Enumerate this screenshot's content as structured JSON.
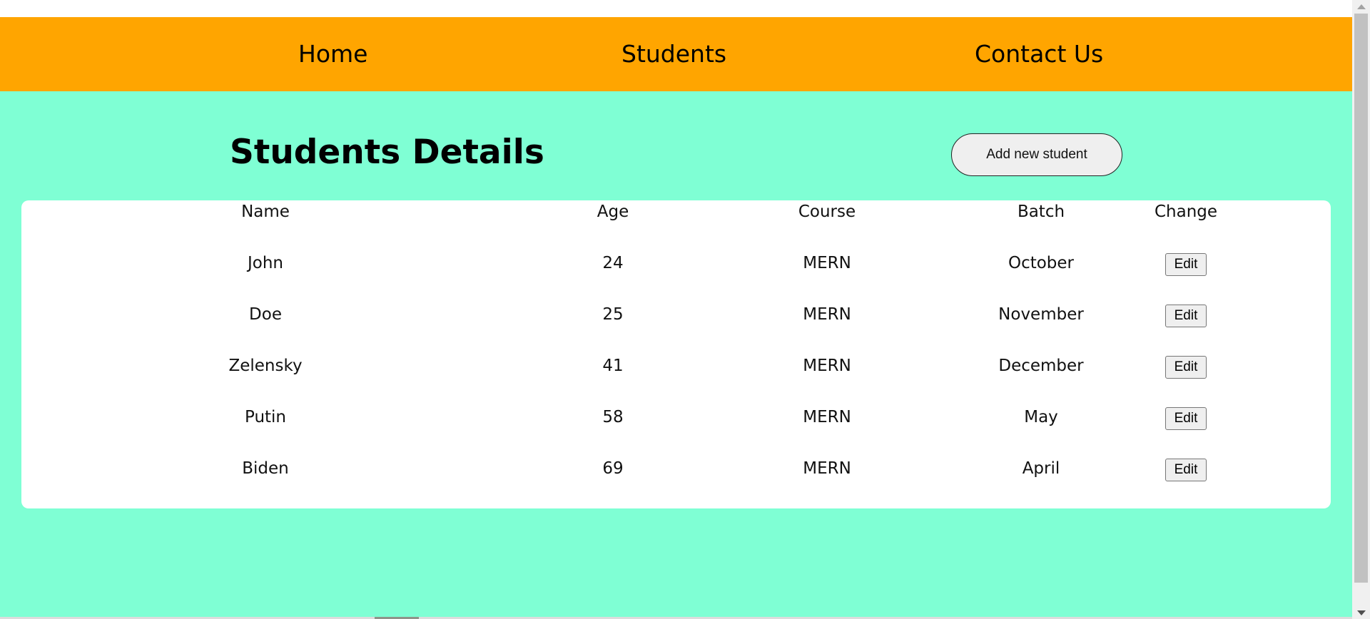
{
  "nav": {
    "home": "Home",
    "students": "Students",
    "contact": "Contact Us"
  },
  "main": {
    "title": "Students Details",
    "add_button": "Add new student"
  },
  "table": {
    "headers": [
      "Name",
      "Age",
      "Course",
      "Batch",
      "Change"
    ],
    "rows": [
      {
        "name": "John",
        "age": "24",
        "course": "MERN",
        "batch": "October",
        "action": "Edit"
      },
      {
        "name": "Doe",
        "age": "25",
        "course": "MERN",
        "batch": "November",
        "action": "Edit"
      },
      {
        "name": "Zelensky",
        "age": "41",
        "course": "MERN",
        "batch": "December",
        "action": "Edit"
      },
      {
        "name": "Putin",
        "age": "58",
        "course": "MERN",
        "batch": "May",
        "action": "Edit"
      },
      {
        "name": "Biden",
        "age": "69",
        "course": "MERN",
        "batch": "April",
        "action": "Edit"
      }
    ]
  },
  "colors": {
    "navbar": "#ffa500",
    "background": "#7fffd4",
    "card": "#ffffff"
  }
}
